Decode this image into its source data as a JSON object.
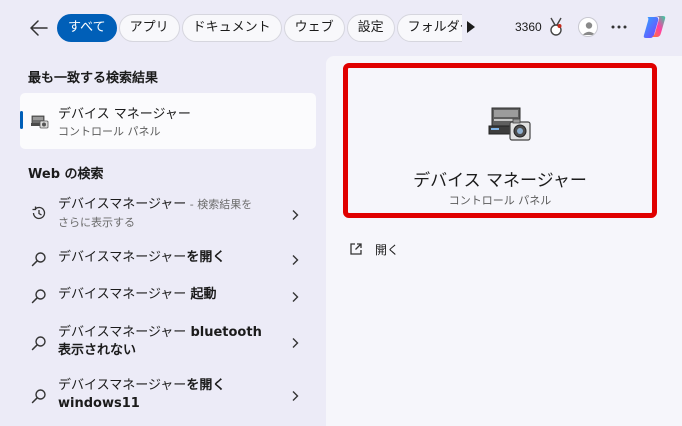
{
  "topbar": {
    "tabs": [
      {
        "label": "すべて",
        "active": true
      },
      {
        "label": "アプリ"
      },
      {
        "label": "ドキュメント"
      },
      {
        "label": "ウェブ"
      },
      {
        "label": "設定"
      },
      {
        "label": "フォルダー"
      }
    ],
    "points": "3360",
    "icons": [
      "back-arrow-icon",
      "play-icon",
      "medal-icon",
      "avatar-icon",
      "more-icon",
      "copilot-icon"
    ]
  },
  "best_match": {
    "heading": "最も一致する検索結果",
    "title": "デバイス マネージャー",
    "subtitle": "コントロール パネル"
  },
  "web": {
    "heading": "Web の検索",
    "items": [
      {
        "icon": "history-icon",
        "normal": "デバイスマネージャー",
        "dim": " - 検索結果を",
        "line2": "さらに表示する"
      },
      {
        "icon": "search-icon",
        "normal": "デバイスマネージャー",
        "bold": "を開く"
      },
      {
        "icon": "search-icon",
        "normal": "デバイスマネージャー ",
        "bold": "起動"
      },
      {
        "icon": "search-icon",
        "normal": "デバイスマネージャー ",
        "bold": "bluetooth",
        "line2_bold": "表示されない"
      },
      {
        "icon": "search-icon",
        "normal": "デバイスマネージャー",
        "bold": "を開く",
        "line2_bold": "windows11"
      }
    ]
  },
  "detail": {
    "title": "デバイス マネージャー",
    "subtitle": "コントロール パネル",
    "actions": [
      {
        "label": "開く",
        "icon": "open-external-icon"
      }
    ]
  },
  "colors": {
    "accent": "#005fb8",
    "highlight_border": "#e00000",
    "background": "#ecebf7"
  }
}
